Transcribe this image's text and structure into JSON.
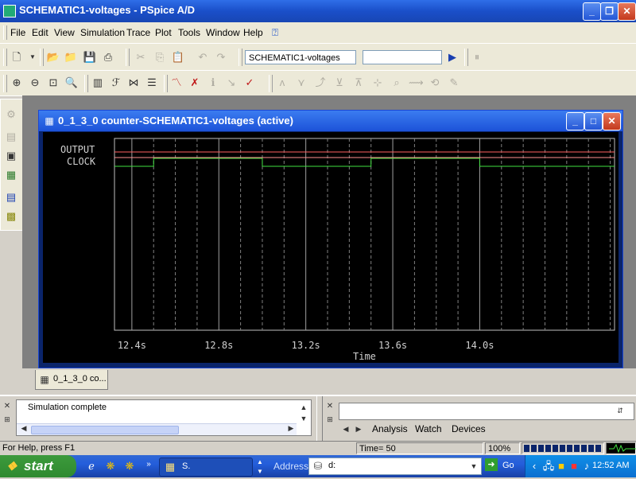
{
  "window": {
    "title": "SCHEMATIC1-voltages - PSpice A/D"
  },
  "menu": [
    "File",
    "Edit",
    "View",
    "Simulation",
    "Trace",
    "Plot",
    "Tools",
    "Window",
    "Help"
  ],
  "toolbar": {
    "profile_value": "SCHEMATIC1-voltages",
    "secondary_value": ""
  },
  "probe": {
    "title": "0_1_3_0 counter-SCHEMATIC1-voltages (active)",
    "trace_labels": [
      "OUTPUT",
      "CLOCK"
    ],
    "x_axis_label": "Time",
    "tab_label": "0_1_3_0 co..."
  },
  "chart_data": {
    "type": "line",
    "xlabel": "Time",
    "ylabel": "",
    "xlim": [
      "12.32s",
      "14.62s"
    ],
    "x_ticks": [
      "12.4s",
      "12.8s",
      "13.2s",
      "13.6s",
      "14.0s"
    ],
    "grid": true,
    "series": [
      {
        "name": "OUTPUT",
        "color": "#ff6060",
        "x": [
          12.32,
          14.62
        ],
        "y": [
          1,
          1
        ]
      },
      {
        "name": "CLOCK",
        "color": "#40e040",
        "x": [
          12.32,
          12.5,
          12.5,
          13.0,
          13.0,
          13.5,
          13.5,
          14.0,
          14.0,
          14.62
        ],
        "y": [
          0,
          0,
          1,
          1,
          0,
          0,
          1,
          1,
          0,
          0
        ]
      }
    ]
  },
  "output": {
    "message": "Simulation complete"
  },
  "watch_tabs": [
    "Analysis",
    "Watch",
    "Devices"
  ],
  "status": {
    "help": "For Help, press F1",
    "time": "Time= 50",
    "zoom": "100%"
  },
  "taskbar": {
    "start": "start",
    "task_label": "S.",
    "address_label": "Address",
    "address_value": "d:",
    "go_label": "Go",
    "clock": "12:52 AM"
  }
}
